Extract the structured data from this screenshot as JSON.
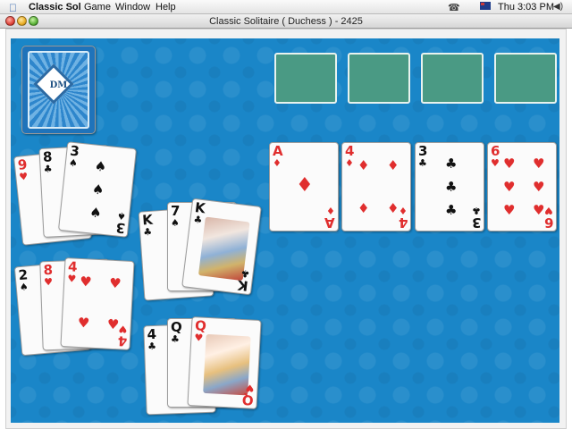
{
  "menubar": {
    "app_name": "Classic Sol",
    "menus": [
      "Game",
      "Window",
      "Help"
    ],
    "clock": "Thu 3:03 PM"
  },
  "window": {
    "title": "Classic Solitaire ( Duchess ) - 2425"
  },
  "foundations": [
    {
      "rank": "A",
      "suit": "♦",
      "color": "red"
    },
    {
      "rank": "4",
      "suit": "♦",
      "color": "red"
    },
    {
      "rank": "3",
      "suit": "♣",
      "color": "black"
    },
    {
      "rank": "6",
      "suit": "♥",
      "color": "red"
    }
  ],
  "reserve_piles": [
    {
      "name": "reserve-top-left",
      "cards": [
        {
          "rank": "9",
          "suit": "♥",
          "color": "red"
        },
        {
          "rank": "8",
          "suit": "♣",
          "color": "black"
        },
        {
          "rank": "3",
          "suit": "♠",
          "color": "black"
        }
      ]
    },
    {
      "name": "reserve-bottom-left",
      "cards": [
        {
          "rank": "2",
          "suit": "♠",
          "color": "black"
        },
        {
          "rank": "8",
          "suit": "♥",
          "color": "red"
        },
        {
          "rank": "4",
          "suit": "♥",
          "color": "red"
        }
      ]
    },
    {
      "name": "reserve-top-middle",
      "cards": [
        {
          "rank": "K",
          "suit": "♣",
          "color": "black"
        },
        {
          "rank": "7",
          "suit": "♠",
          "color": "black"
        },
        {
          "rank": "K",
          "suit": "♣",
          "color": "black"
        }
      ]
    },
    {
      "name": "reserve-bottom-middle",
      "cards": [
        {
          "rank": "4",
          "suit": "♣",
          "color": "black"
        },
        {
          "rank": "Q",
          "suit": "♣",
          "color": "black"
        },
        {
          "rank": "Q",
          "suit": "♥",
          "color": "red"
        }
      ]
    }
  ],
  "deck": {
    "monogram": "DM"
  },
  "colors": {
    "table": "#1a86c8",
    "slot": "#4a9a84",
    "red_suit": "#e02e2e"
  }
}
